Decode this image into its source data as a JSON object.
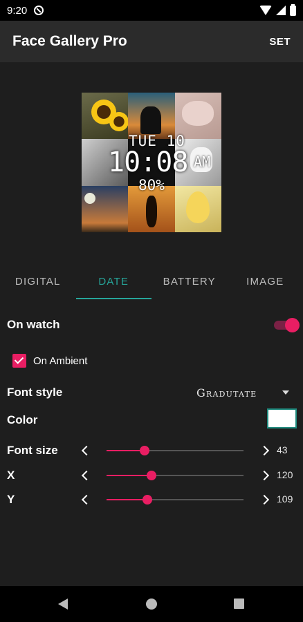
{
  "status_bar": {
    "time": "9:20"
  },
  "app_bar": {
    "title": "Face Gallery Pro",
    "set_label": "SET"
  },
  "watch_preview": {
    "date": "TUE 10",
    "time": "10:08",
    "ampm": "AM",
    "battery": "80%"
  },
  "tabs": [
    {
      "label": "DIGITAL",
      "active": false
    },
    {
      "label": "DATE",
      "active": true
    },
    {
      "label": "BATTERY",
      "active": false
    },
    {
      "label": "IMAGE",
      "active": false
    }
  ],
  "settings": {
    "on_watch": {
      "label": "On watch",
      "enabled": true
    },
    "on_ambient": {
      "label": "On Ambient",
      "checked": true
    },
    "font_style": {
      "label": "Font style",
      "value": "Gradutate"
    },
    "color": {
      "label": "Color",
      "value": "#ffffff"
    },
    "font_size": {
      "label": "Font size",
      "value": "43",
      "fraction": 0.28
    },
    "x": {
      "label": "X",
      "value": "120",
      "fraction": 0.33
    },
    "y": {
      "label": "Y",
      "value": "109",
      "fraction": 0.3
    }
  },
  "colors": {
    "accent": "#e91e63",
    "tab_active": "#26a69a",
    "background": "#1e1e1e",
    "app_bar": "#2b2b2b"
  }
}
